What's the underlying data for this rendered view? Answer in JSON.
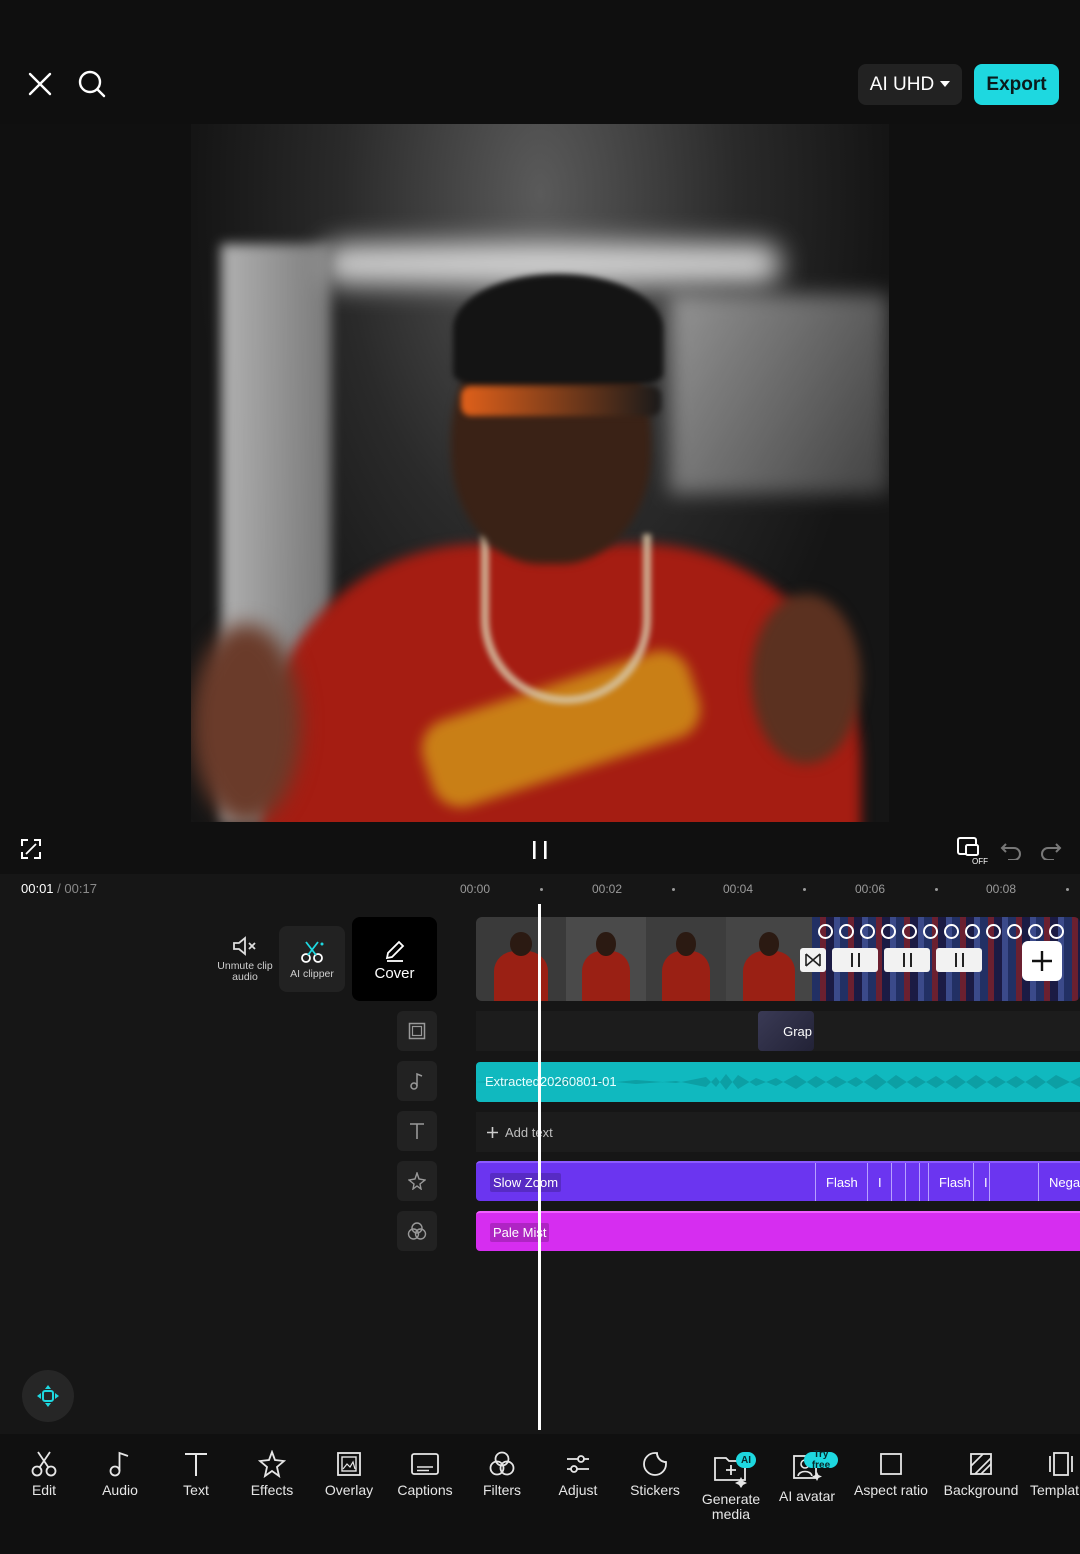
{
  "header": {
    "quality_label": "AI UHD",
    "export_label": "Export"
  },
  "player": {
    "current_time": "00:01",
    "separator": "/",
    "total_time": "00:17"
  },
  "ruler": {
    "labels": [
      "00:00",
      "00:02",
      "00:04",
      "00:06",
      "00:08"
    ]
  },
  "clip_tools": {
    "unmute_label": "Unmute clip audio",
    "ai_clipper_label": "AI clipper",
    "cover_label": "Cover"
  },
  "tracks": {
    "graphic_label": "Grap",
    "audio_label": "Extracted20260801-01",
    "add_text_label": "Add text",
    "effects": [
      "Slow Zoom",
      "Flash",
      "I",
      "Flash",
      "I",
      "Nega"
    ],
    "filter_label": "Pale Mist"
  },
  "toolbar": {
    "items": [
      "Edit",
      "Audio",
      "Text",
      "Effects",
      "Overlay",
      "Captions",
      "Filters",
      "Adjust",
      "Stickers",
      "Generate media",
      "AI avatar",
      "Aspect ratio",
      "Background",
      "Templat"
    ],
    "badges": {
      "generate_media": "AI",
      "ai_avatar": "Try free"
    }
  },
  "colors": {
    "accent": "#1ed8e0",
    "audio": "#10b9bf",
    "effect": "#6b35f0",
    "filter": "#d62df0"
  }
}
